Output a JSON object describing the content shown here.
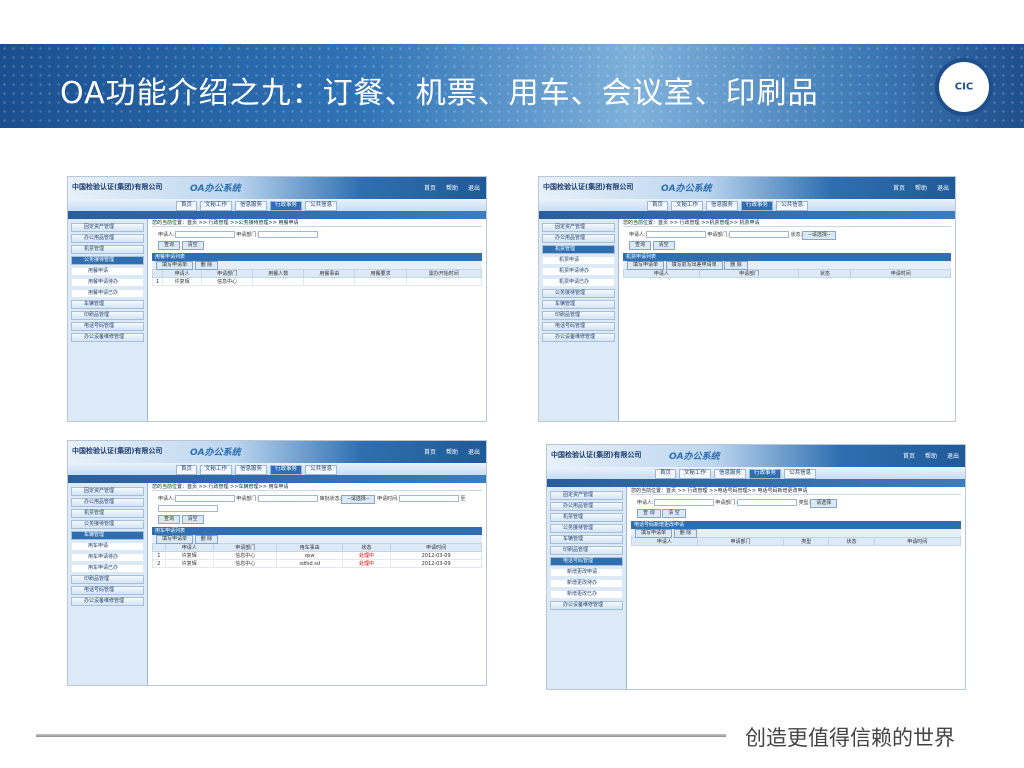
{
  "slide": {
    "title": "OA功能介绍之九：订餐、机票、用车、会议室、印刷品",
    "logo_text": "CIC",
    "slogan": "创造更值得信赖的世界"
  },
  "app": {
    "company": "中国检验认证(集团)有限公司",
    "oa_title": "OA办公系统",
    "top_links": [
      "首页",
      "帮助",
      "退出"
    ],
    "nav_tabs": [
      "首页",
      "文秘工作",
      "信息服务",
      "行政事务",
      "公共信息"
    ]
  },
  "shots": [
    {
      "breadcrumb": "您的当前位置：首页 >> 行政管理 >>公务接待管理>> 用餐申请",
      "side": [
        "固定资产管理",
        "办公用品管理",
        "机票管理",
        "公务接待管理",
        "用餐申请",
        "用餐申请待办",
        "用餐申请已办",
        "车辆管理",
        "印刷品管理",
        "电话号码管理",
        "办公设备维修管理"
      ],
      "form_labels": [
        "申请人:",
        "申请部门:"
      ],
      "buttons": [
        "查询",
        "清空"
      ],
      "grid_title": "用餐申请列表",
      "toolbar": [
        "填写申请单",
        "删 除"
      ],
      "columns": [
        "",
        "申请人",
        "申请部门",
        "用餐人数",
        "用餐事由",
        "用餐要求",
        "需办开始时间"
      ],
      "rows": [
        [
          "1",
          "许复辉",
          "信息中心",
          "",
          "",
          "",
          ""
        ]
      ]
    },
    {
      "breadcrumb": "您的当前位置：首页 >> 行政管理 >>机票管理>> 机票申请",
      "side": [
        "固定资产管理",
        "办公用品管理",
        "机票管理",
        "机票申请",
        "机票申请待办",
        "机票申请已办",
        "公务接待管理",
        "车辆管理",
        "印刷品管理",
        "电话号码管理",
        "办公设备维修管理"
      ],
      "form_labels": [
        "申请人:",
        "申请部门:",
        "状态:"
      ],
      "select_value": "--请选择--",
      "buttons": [
        "查询",
        "清空"
      ],
      "grid_title": "机票申请列表",
      "toolbar": [
        "填写申请单",
        "填写前写出差申请单",
        "删 除"
      ],
      "columns": [
        "申请人",
        "申请部门",
        "状态",
        "申请时间"
      ],
      "rows": []
    },
    {
      "breadcrumb": "您的当前位置：首页 >> 行政管理 >>车辆管理>> 用车申请",
      "side": [
        "固定资产管理",
        "办公用品管理",
        "机票管理",
        "公务接待管理",
        "车辆管理",
        "用车申请",
        "用车申请待办",
        "用车申请已办",
        "印刷品管理",
        "电话号码管理",
        "办公设备维修管理"
      ],
      "form_labels": [
        "申请人:",
        "申请部门:",
        "审批状态:",
        "申请时间:",
        "至"
      ],
      "select_value": "--请选择--",
      "buttons": [
        "查询",
        "清空"
      ],
      "grid_title": "用车申请列表",
      "toolbar": [
        "填写申请单",
        "删 除"
      ],
      "columns": [
        "",
        "申请人",
        "申请部门",
        "用车事由",
        "状态",
        "申请时间"
      ],
      "rows": [
        [
          "1",
          "许复辉",
          "信息中心",
          "qsw",
          "处理中",
          "2012-03-09"
        ],
        [
          "2",
          "许复辉",
          "信息中心",
          "sdfsd sd",
          "处理中",
          "2012-03-09"
        ]
      ]
    },
    {
      "breadcrumb": "您的当前位置：首页 >> 行政管理 >>电话号码管理>> 电话号码新增更改申请",
      "side": [
        "固定资产管理",
        "办公用品管理",
        "机票管理",
        "公务接待管理",
        "车辆管理",
        "印刷品管理",
        "电话号码管理",
        "新增更改申请",
        "新增更改待办",
        "新增更改已办",
        "办公设备维修管理"
      ],
      "form_labels": [
        "申请人:",
        "申请部门:",
        "类型:"
      ],
      "select_value": "请选择",
      "buttons": [
        "查 询",
        "清 空"
      ],
      "grid_title": "电话号码新增更改申请",
      "toolbar": [
        "填写申请单",
        "删 除"
      ],
      "columns": [
        "申请人",
        "申请部门",
        "类型",
        "状态",
        "申请时间"
      ],
      "rows": []
    }
  ]
}
